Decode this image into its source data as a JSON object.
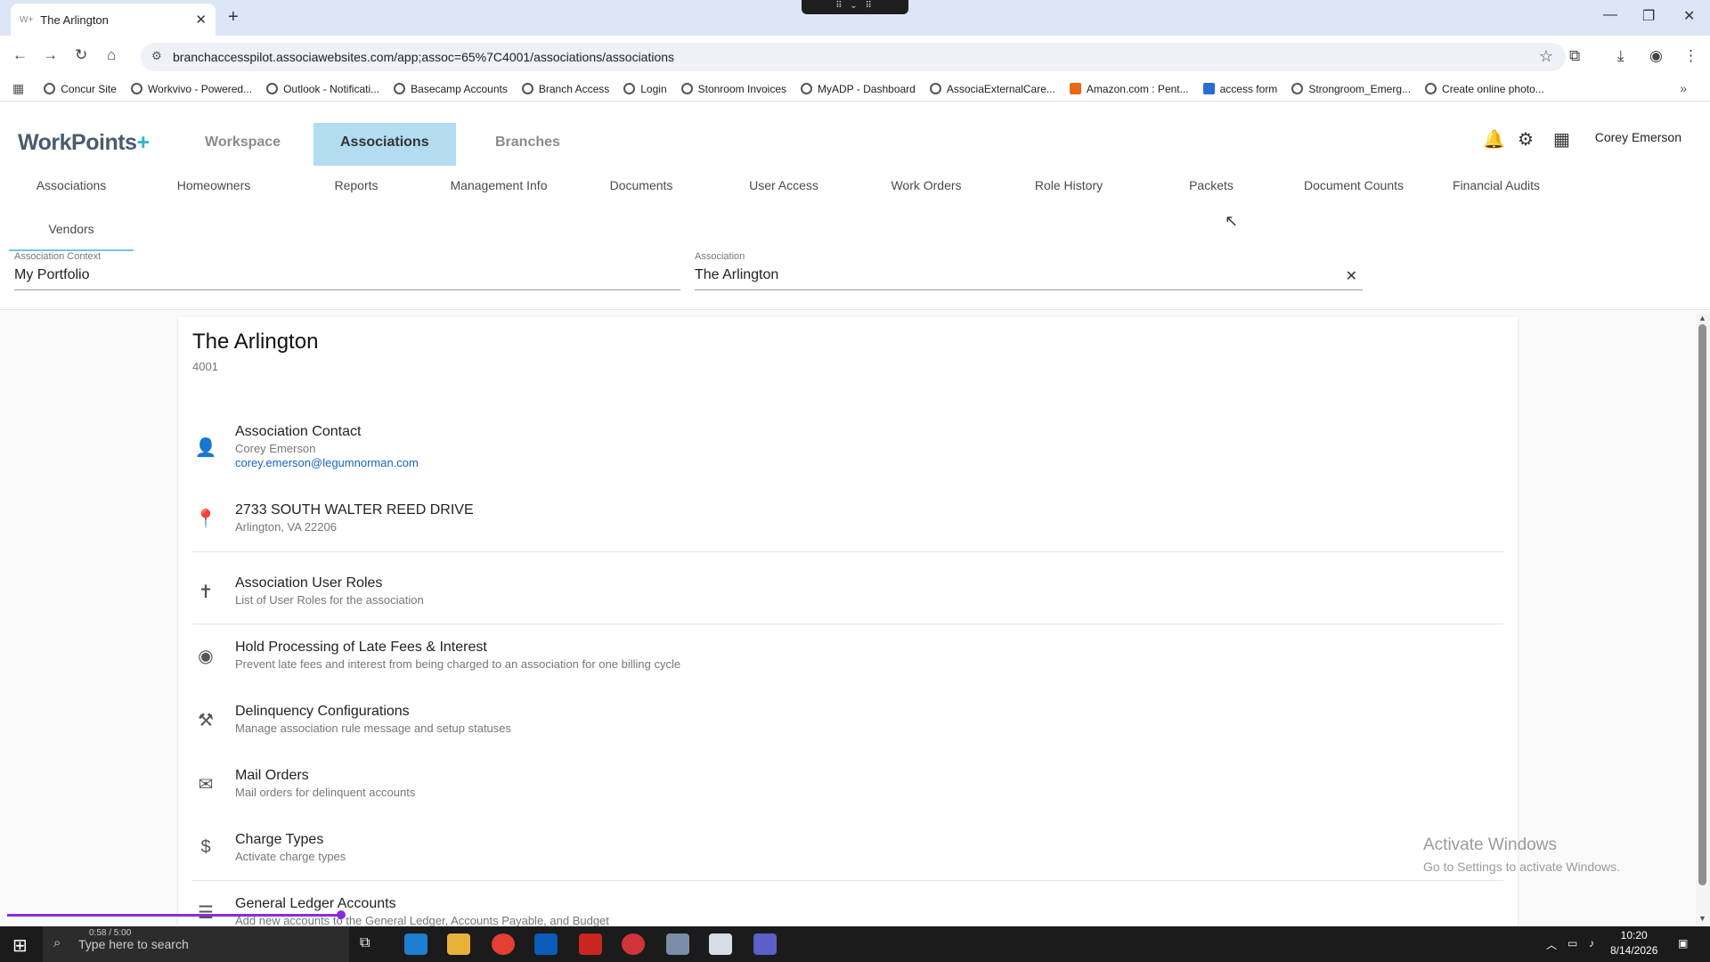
{
  "browser": {
    "tab_title": "The Arlington",
    "tab_favicon": "W+",
    "url": "branchaccesspilot.associawebsites.com/app;assoc=65%7C4001/associations/associations",
    "bookmarks": [
      "Concur Site",
      "Workvivo - Powered...",
      "Outlook - Notificati...",
      "Basecamp Accounts",
      "Branch Access",
      "Login",
      "Stonroom Invoices",
      "MyADP - Dashboard",
      "AssociaExternalCare...",
      "Amazon.com : Pent...",
      "access form",
      "Strongroom_Emerg...",
      "Create online photo..."
    ]
  },
  "app": {
    "logo_main": "WorkPoints",
    "logo_plus": "+",
    "top_tabs": [
      "Workspace",
      "Associations",
      "Branches"
    ],
    "active_top_tab": "Associations",
    "user_name": "Corey Emerson",
    "icons": [
      "bell-icon",
      "gear-icon",
      "apps-grid-icon"
    ],
    "sub_tabs": [
      "Associations",
      "Homeowners",
      "Reports",
      "Management Info",
      "Documents",
      "User Access",
      "Work Orders",
      "Role History",
      "Packets",
      "Document Counts",
      "Financial Audits",
      "Vendors"
    ],
    "selected_sub_tab": "Vendors"
  },
  "context": {
    "association_context_label": "Association Context",
    "association_context_value": "My Portfolio",
    "association_label": "Association",
    "association_value": "The Arlington"
  },
  "card": {
    "title": "The Arlington",
    "number": "4001",
    "items": [
      {
        "icon": "person-icon",
        "title": "Association Contact",
        "sub": "Corey Emerson",
        "link": "corey.emerson@legumnorman.com"
      },
      {
        "icon": "location-pin-icon",
        "title": "2733 SOUTH WALTER REED DRIVE",
        "sub": "Arlington, VA 22206"
      },
      {
        "icon": "accessibility-icon",
        "title": "Association User Roles",
        "sub": "List of User Roles for the association"
      },
      {
        "icon": "radio-button-icon",
        "title": "Hold Processing of Late Fees & Interest",
        "sub": "Prevent late fees and interest from being charged to an association for one billing cycle"
      },
      {
        "icon": "gavel-icon",
        "title": "Delinquency Configurations",
        "sub": "Manage association rule message and setup statuses"
      },
      {
        "icon": "mail-icon",
        "title": "Mail Orders",
        "sub": "Mail orders for delinquent accounts"
      },
      {
        "icon": "dollar-icon",
        "title": "Charge Types",
        "sub": "Activate charge types"
      },
      {
        "icon": "list-icon",
        "title": "General Ledger Accounts",
        "sub": "Add new accounts to the General Ledger, Accounts Payable, and Budget"
      }
    ]
  },
  "watermark": {
    "line1": "Activate Windows",
    "line2": "Go to Settings to activate Windows."
  },
  "taskbar": {
    "search_placeholder": "Type here to search",
    "media_time": "0:58 / 5:00",
    "clock_time": "10:20",
    "clock_date": "8/14/2026"
  },
  "colors": {
    "active_tab_bg": "#b3dcf0",
    "link": "#1565c0",
    "logo_accent": "#2eb6c9",
    "progress": "#8a2be2"
  }
}
